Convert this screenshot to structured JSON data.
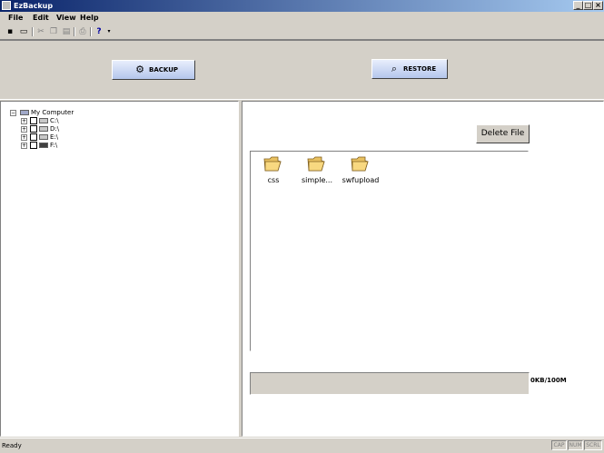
{
  "window": {
    "title": "EzBackup"
  },
  "menu": {
    "items": [
      "File",
      "Edit",
      "View",
      "Help"
    ]
  },
  "toolbar": {
    "icons": [
      "save-icon",
      "open-icon",
      "cut-icon",
      "copy-icon",
      "paste-icon",
      "print-icon",
      "help-icon"
    ]
  },
  "actions": {
    "backup_label": "BACKUP",
    "restore_label": "RESTORE"
  },
  "tree": {
    "root": "My Computer",
    "drives": [
      "C:\\",
      "D:\\",
      "E:\\",
      "F:\\"
    ]
  },
  "files": {
    "delete_label": "Delete File",
    "items": [
      "css",
      "simple...",
      "swfupload"
    ]
  },
  "progress": {
    "text": "0KB/100M",
    "fraction": 0
  },
  "status": {
    "text": "Ready",
    "indicators": [
      "CAP",
      "NUM",
      "SCRL"
    ]
  },
  "colors": {
    "title_bar": "#0a246a",
    "window_bg": "#d4d0c8",
    "button_accent": "#b4c6ec"
  }
}
